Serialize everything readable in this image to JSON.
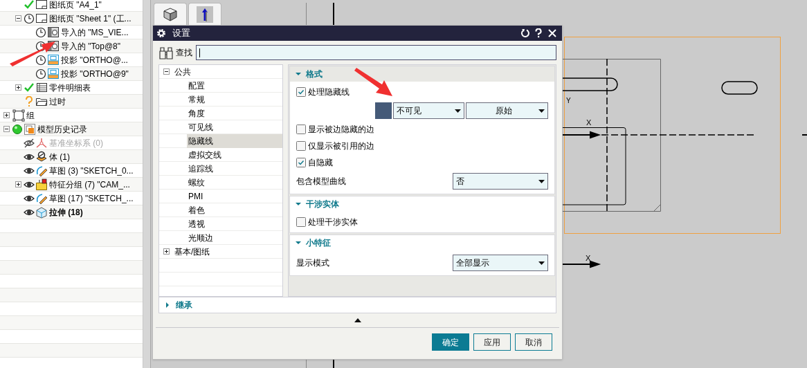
{
  "part_navigator": {
    "continued_branch": [
      {
        "kind": "sheet",
        "up_to_date": true,
        "label": "图纸页 \"A4_1\""
      },
      {
        "kind": "sheet",
        "up_to_date": false,
        "label": "图纸页 \"Sheet 1\" (工...",
        "expanded": true,
        "children": [
          {
            "kind": "imported",
            "up_to_date": false,
            "label": "导入的 \"MS_VIE..."
          },
          {
            "kind": "imported",
            "up_to_date": false,
            "label": "导入的 \"Top@8\""
          },
          {
            "kind": "projected",
            "up_to_date": false,
            "label": "投影 \"ORTHO@..."
          },
          {
            "kind": "projected",
            "up_to_date": false,
            "label": "投影 \"ORTHO@9\""
          }
        ]
      },
      {
        "kind": "partslist",
        "up_to_date": true,
        "label": "零件明细表",
        "expanded": false
      },
      {
        "kind": "folder",
        "label": "过时"
      }
    ],
    "items": [
      {
        "kind": "group",
        "label": "组",
        "expanded": false
      },
      {
        "kind": "history",
        "label": "模型历史记录",
        "expanded": true,
        "children": [
          {
            "kind": "datum",
            "visible": false,
            "label": "基准坐标系 (0)",
            "disabled": true
          },
          {
            "kind": "body",
            "visible": true,
            "label": "体 (1)"
          },
          {
            "kind": "sketch",
            "visible": true,
            "label": "草图 (3) \"SKETCH_0..."
          },
          {
            "kind": "featuregroup",
            "visible": true,
            "label": "特征分组 (7) \"CAM_...",
            "expanded": false
          },
          {
            "kind": "sketch",
            "visible": true,
            "label": "草图 (17) \"SKETCH_..."
          },
          {
            "kind": "extrude",
            "visible": true,
            "label": "拉伸 (18)",
            "current": true
          }
        ]
      }
    ]
  },
  "view_tabs": [
    {
      "kind": "cube"
    },
    {
      "kind": "arrow"
    }
  ],
  "drawing": {
    "axis_labels": [
      "Y",
      "X",
      "X"
    ]
  },
  "dialog": {
    "title": "设置",
    "find": {
      "label": "查找"
    },
    "categories": [
      {
        "label": "公共",
        "expanded": true,
        "children": [
          {
            "label": "配置",
            "selected": false
          },
          {
            "label": "常规",
            "selected": false
          },
          {
            "label": "角度",
            "selected": false
          },
          {
            "label": "可见线",
            "selected": false
          },
          {
            "label": "隐藏线",
            "selected": true
          },
          {
            "label": "虚拟交线",
            "selected": false
          },
          {
            "label": "追踪线",
            "selected": false
          },
          {
            "label": "螺纹",
            "selected": false
          },
          {
            "label": "PMI",
            "selected": false
          },
          {
            "label": "着色",
            "selected": false
          },
          {
            "label": "透视",
            "selected": false
          },
          {
            "label": "光顺边",
            "selected": false
          }
        ]
      },
      {
        "label": "基本/图纸",
        "expanded": false
      }
    ],
    "sections": [
      {
        "title": "格式",
        "expanded": true,
        "rows": [
          {
            "kind": "checkbox",
            "label": "处理隐藏线",
            "checked": true
          },
          {
            "kind": "style",
            "color": "#455a78",
            "value": "不可见",
            "value_2": "原始"
          },
          {
            "kind": "checkbox",
            "label": "显示被边隐藏的边",
            "checked": false
          },
          {
            "kind": "checkbox",
            "label": "仅显示被引用的边",
            "checked": false
          },
          {
            "kind": "checkbox",
            "label": "自隐藏",
            "checked": true
          },
          {
            "kind": "dropdown",
            "label": "包含模型曲线",
            "value": "否"
          }
        ]
      },
      {
        "title": "干涉实体",
        "expanded": true,
        "rows": [
          {
            "kind": "checkbox",
            "label": "处理干涉实体",
            "checked": false
          }
        ]
      },
      {
        "title": "小特征",
        "expanded": true,
        "rows": [
          {
            "kind": "dropdown",
            "label": "显示模式",
            "value": "全部显示"
          }
        ]
      }
    ],
    "inherit_section": {
      "title": "继承",
      "expanded": false
    },
    "buttons": [
      {
        "label": "确定",
        "primary": true
      },
      {
        "label": "应用",
        "primary": false
      },
      {
        "label": "取消",
        "primary": false
      }
    ]
  }
}
